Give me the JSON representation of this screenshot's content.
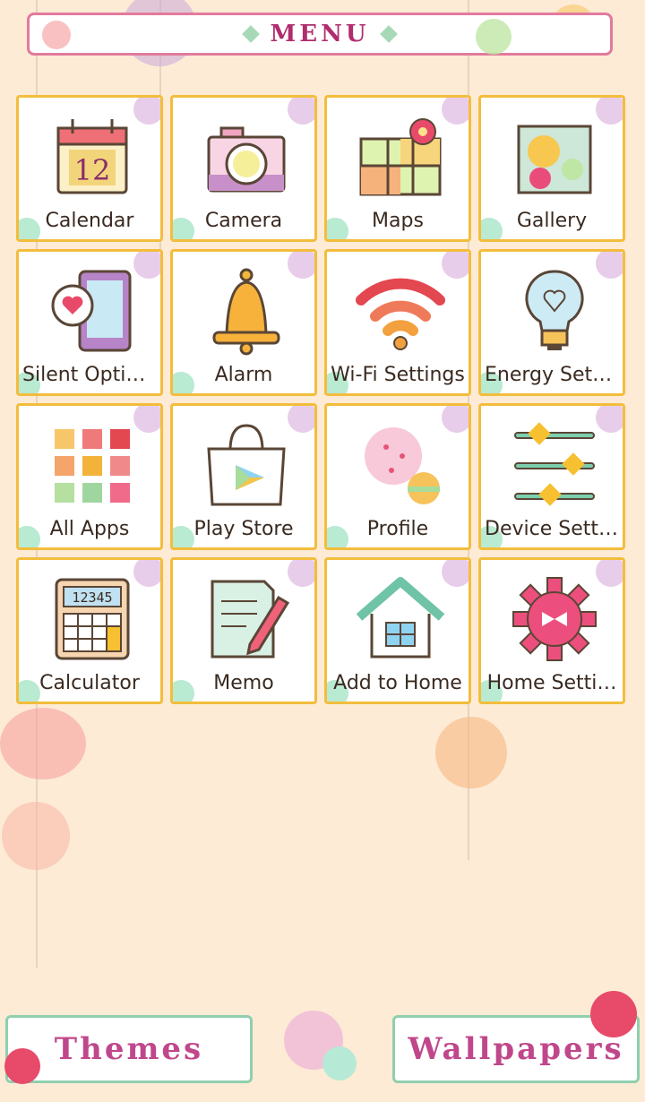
{
  "header": {
    "title": "MENU"
  },
  "colors": {
    "tile_border": "#f3bd3c",
    "title": "#b02d6e",
    "bottom_text": "#c0478b"
  },
  "tiles": [
    {
      "label": "Calendar",
      "icon": "calendar-icon",
      "date": "12"
    },
    {
      "label": "Camera",
      "icon": "camera-icon"
    },
    {
      "label": "Maps",
      "icon": "map-icon"
    },
    {
      "label": "Gallery",
      "icon": "gallery-icon"
    },
    {
      "label": "Silent Options",
      "icon": "phone-heart-icon"
    },
    {
      "label": "Alarm",
      "icon": "bell-icon"
    },
    {
      "label": "Wi-Fi Settings",
      "icon": "wifi-icon"
    },
    {
      "label": "Energy Setti…",
      "icon": "lightbulb-icon"
    },
    {
      "label": "All Apps",
      "icon": "app-grid-icon"
    },
    {
      "label": "Play Store",
      "icon": "shopping-bag-icon"
    },
    {
      "label": "Profile",
      "icon": "profile-ball-icon"
    },
    {
      "label": "Device Setti…",
      "icon": "sliders-icon"
    },
    {
      "label": "Calculator",
      "icon": "calculator-icon",
      "display": "12345"
    },
    {
      "label": "Memo",
      "icon": "memo-icon"
    },
    {
      "label": "Add to Home",
      "icon": "house-icon"
    },
    {
      "label": "Home Setti…",
      "icon": "gear-icon"
    }
  ],
  "bottom": {
    "themes": "Themes",
    "wallpapers": "Wallpapers"
  }
}
